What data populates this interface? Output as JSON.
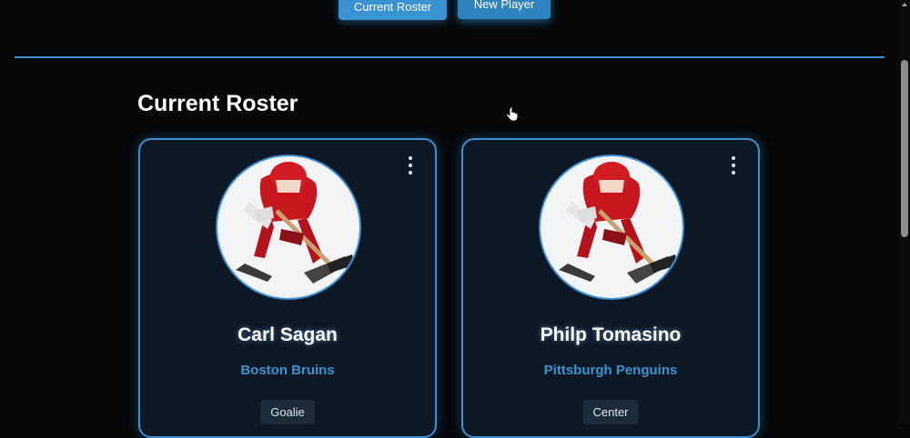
{
  "nav": {
    "current_roster": "Current Roster",
    "new_player": "New Player"
  },
  "page": {
    "title": "Current Roster"
  },
  "players": [
    {
      "name": "Carl Sagan",
      "team": "Boston Bruins",
      "position": "Goalie"
    },
    {
      "name": "Philp Tomasino",
      "team": "Pittsburgh Penguins",
      "position": "Center"
    }
  ],
  "colors": {
    "accent": "#3b8fd3",
    "team_text": "#3a93d1",
    "card_bg": "#0e1825",
    "page_bg": "#050709"
  },
  "icons": [
    "kebab-menu-icon",
    "hockey-player-avatar",
    "pointer-cursor-icon"
  ]
}
